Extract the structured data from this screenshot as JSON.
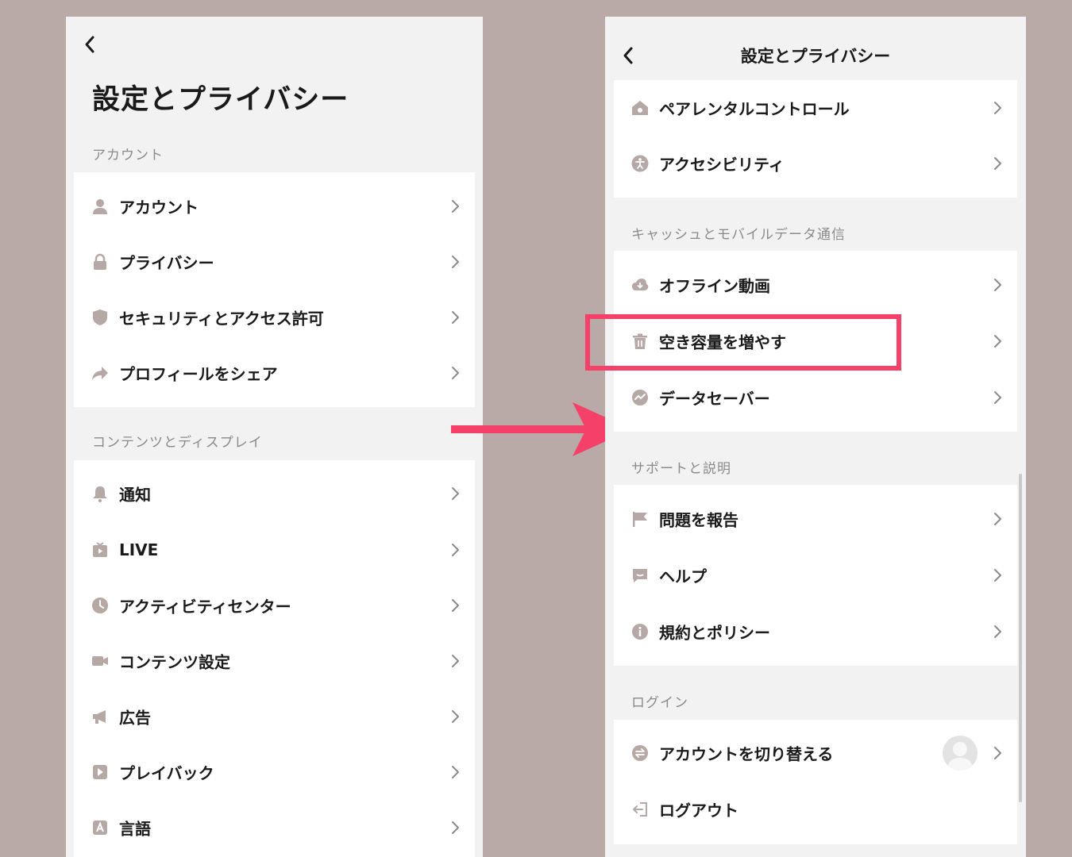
{
  "left_screen": {
    "title": "設定とプライバシー",
    "sections": [
      {
        "label": "アカウント",
        "items": [
          {
            "label": "アカウント",
            "icon": "person-icon"
          },
          {
            "label": "プライバシー",
            "icon": "lock-icon"
          },
          {
            "label": "セキュリティとアクセス許可",
            "icon": "shield-icon"
          },
          {
            "label": "プロフィールをシェア",
            "icon": "share-icon"
          }
        ]
      },
      {
        "label": "コンテンツとディスプレイ",
        "items": [
          {
            "label": "通知",
            "icon": "bell-icon"
          },
          {
            "label": "LIVE",
            "icon": "tv-icon"
          },
          {
            "label": "アクティビティセンター",
            "icon": "clock-icon"
          },
          {
            "label": "コンテンツ設定",
            "icon": "video-camera-icon"
          },
          {
            "label": "広告",
            "icon": "megaphone-icon"
          },
          {
            "label": "プレイバック",
            "icon": "play-icon"
          },
          {
            "label": "言語",
            "icon": "language-icon"
          }
        ]
      }
    ]
  },
  "right_screen": {
    "title": "設定とプライバシー",
    "top_items": [
      {
        "label": "ペアレンタルコントロール",
        "icon": "home-icon"
      },
      {
        "label": "アクセシビリティ",
        "icon": "accessibility-icon"
      }
    ],
    "sections": [
      {
        "label": "キャッシュとモバイルデータ通信",
        "items": [
          {
            "label": "オフライン動画",
            "icon": "cloud-download-icon"
          },
          {
            "label": "空き容量を増やす",
            "icon": "trash-icon"
          },
          {
            "label": "データセーバー",
            "icon": "data-saver-icon"
          }
        ]
      },
      {
        "label": "サポートと説明",
        "items": [
          {
            "label": "問題を報告",
            "icon": "flag-icon"
          },
          {
            "label": "ヘルプ",
            "icon": "chat-icon"
          },
          {
            "label": "規約とポリシー",
            "icon": "info-icon"
          }
        ]
      },
      {
        "label": "ログイン",
        "items": [
          {
            "label": "アカウントを切り替える",
            "icon": "switch-icon"
          },
          {
            "label": "ログアウト",
            "icon": "logout-icon"
          }
        ]
      }
    ]
  },
  "colors": {
    "background": "#b9aaa7",
    "highlight": "#f5416a",
    "arrow": "#f5416a",
    "icon": "#b5a8a5"
  }
}
